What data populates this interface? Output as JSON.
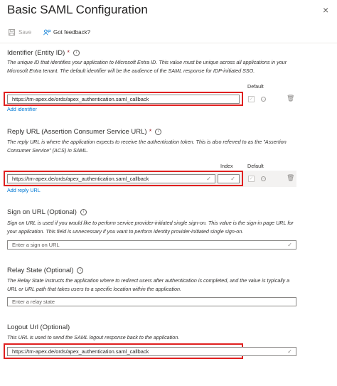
{
  "header": {
    "title": "Basic SAML Configuration",
    "close_glyph": "×"
  },
  "toolbar": {
    "save_label": "Save",
    "feedback_label": "Got feedback?",
    "save_icon": "save-icon",
    "feedback_icon": "feedback-icon"
  },
  "identifier": {
    "title": "Identifier (Entity ID)",
    "required_mark": "*",
    "description": "The unique ID that identifies your application to Microsoft Entra ID. This value must be unique across all applications in your Microsoft Entra tenant. The default identifier will be the audience of the SAML response for IDP-initiated SSO.",
    "column_default": "Default",
    "value": "https://tm-apex.de/ords/apex_authentication.saml_callback",
    "add_link": "Add identifier"
  },
  "reply_url": {
    "title": "Reply URL (Assertion Consumer Service URL)",
    "required_mark": "*",
    "description": "The reply URL is where the application expects to receive the authentication token. This is also referred to as the \"Assertion Consumer Service\" (ACS) in SAML.",
    "column_index": "Index",
    "column_default": "Default",
    "value": "https://tm-apex.de/ords/apex_authentication.saml_callback",
    "add_link": "Add reply URL"
  },
  "sign_on": {
    "title": "Sign on URL (Optional)",
    "description": "Sign on URL is used if you would like to perform service provider-initiated single sign-on. This value is the sign-in page URL for your application. This field is unnecessary if you want to perform identity provider-initiated single sign-on.",
    "placeholder": "Enter a sign on URL"
  },
  "relay_state": {
    "title": "Relay State (Optional)",
    "description": "The Relay State instructs the application where to redirect users after authentication is completed, and the value is typically a URL or URL path that takes users to a specific location within the application.",
    "placeholder": "Enter a relay state"
  },
  "logout": {
    "title": "Logout Url (Optional)",
    "description": "This URL is used to send the SAML logout response back to the application.",
    "value": "https://tm-apex.de/ords/apex_authentication.saml_callback"
  },
  "colors": {
    "accent": "#0078d4",
    "highlight": "#e02020"
  }
}
